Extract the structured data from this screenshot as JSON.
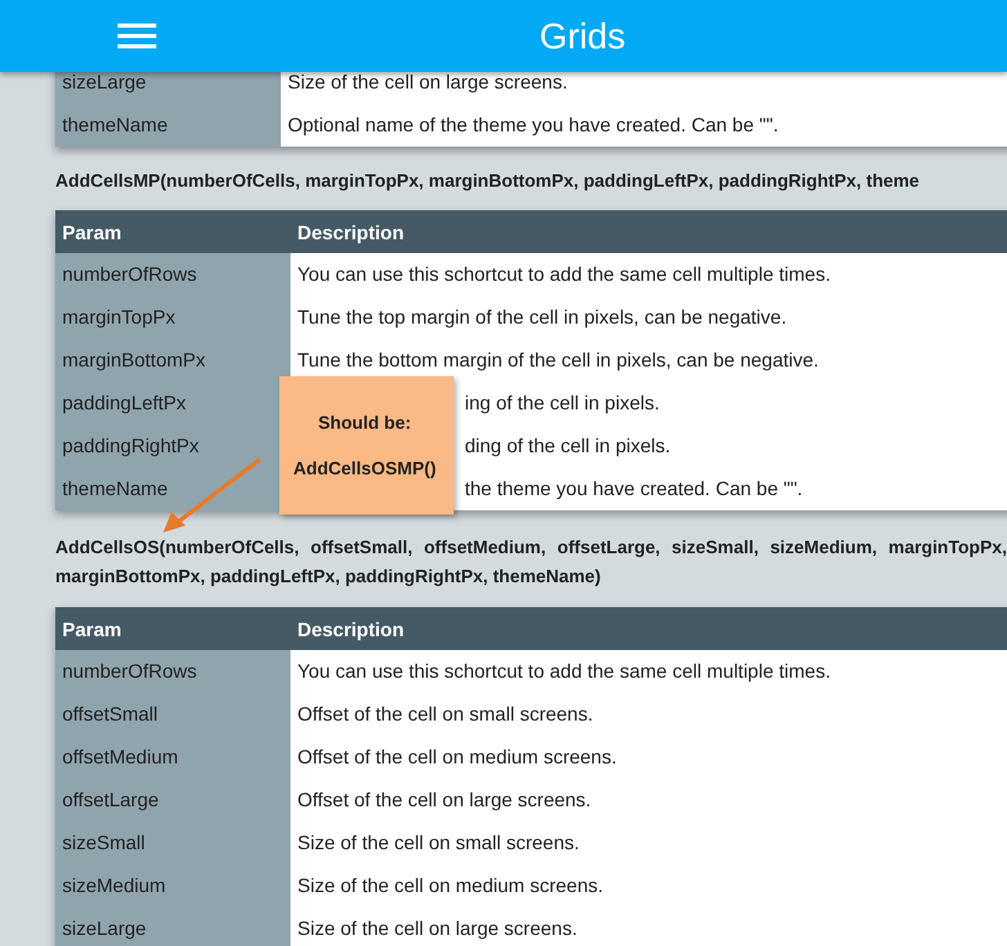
{
  "app_bar": {
    "title": "Grids"
  },
  "sections": [
    {
      "rows": [
        {
          "param": "sizeLarge",
          "description": "Size of the cell on large screens.",
          "kind": "full"
        },
        {
          "param": "themeName",
          "description": "Optional name of the theme you have created. Can be \"\".",
          "kind": "full"
        }
      ]
    },
    {
      "signature": "AddCellsMP(numberOfCells, marginTopPx, marginBottomPx, paddingLeftPx, paddingRightPx, theme",
      "columns": [
        "Param",
        "Description"
      ],
      "rows": [
        {
          "param": "numberOfRows",
          "description": "You can use this schortcut to add the same cell multiple times.",
          "kind": "full"
        },
        {
          "param": "marginTopPx",
          "description": "Tune the top margin of the cell in pixels, can be negative.",
          "kind": "full"
        },
        {
          "param": "marginBottomPx",
          "description": "Tune the bottom margin of the cell in pixels, can be negative.",
          "kind": "full"
        },
        {
          "param": "paddingLeftPx",
          "description": "ing of the cell in pixels.",
          "kind": "partial"
        },
        {
          "param": "paddingRightPx",
          "description": "ding of the cell in pixels.",
          "kind": "partial"
        },
        {
          "param": "themeName",
          "description": "the theme you have created. Can be \"\".",
          "kind": "partial"
        }
      ]
    },
    {
      "signature": "AddCellsOS(numberOfCells, offsetSmall, offsetMedium, offsetLarge, sizeSmall, sizeMedium, marginTopPx, marginBottomPx, paddingLeftPx, paddingRightPx, themeName)",
      "columns": [
        "Param",
        "Description"
      ],
      "rows": [
        {
          "param": "numberOfRows",
          "description": "You can use this schortcut to add the same cell multiple times.",
          "kind": "full"
        },
        {
          "param": "offsetSmall",
          "description": "Offset of the cell on small screens.",
          "kind": "full"
        },
        {
          "param": "offsetMedium",
          "description": "Offset of the cell on medium screens.",
          "kind": "full"
        },
        {
          "param": "offsetLarge",
          "description": "Offset of the cell on large screens.",
          "kind": "full"
        },
        {
          "param": "sizeSmall",
          "description": "Size of the cell on small screens.",
          "kind": "full"
        },
        {
          "param": "sizeMedium",
          "description": "Size of the cell on medium screens.",
          "kind": "full"
        },
        {
          "param": "sizeLarge",
          "description": "Size of the cell on large screens.",
          "kind": "full"
        }
      ]
    }
  ],
  "note": {
    "lines": [
      "Should be:",
      "AddCellsOSMP()"
    ]
  }
}
